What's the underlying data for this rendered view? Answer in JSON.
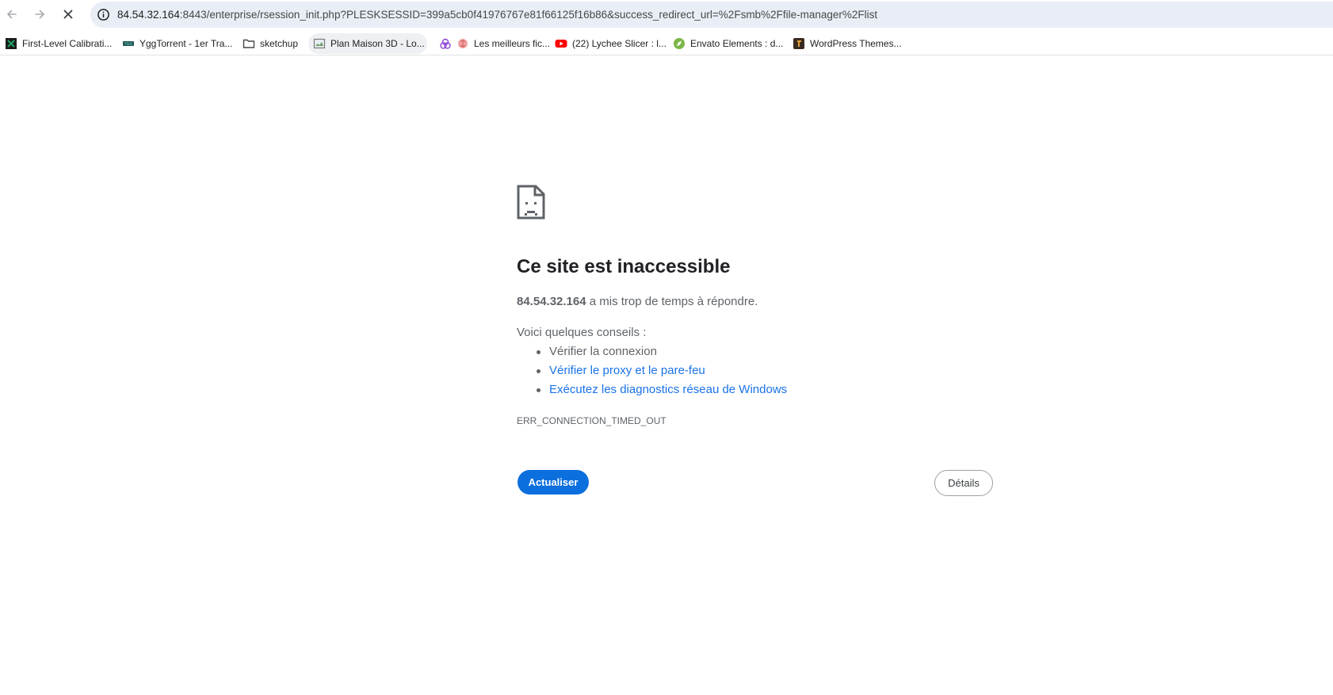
{
  "toolbar": {
    "url_host": "84.54.32.164",
    "url_rest": ":8443/enterprise/rsession_init.php?PLESKSESSID=399a5cb0f41976767e81f66125f16b86&success_redirect_url=%2Fsmb%2Ffile-manager%2Flist",
    "icons": {
      "back": "arrow-left-icon",
      "forward": "arrow-right-icon",
      "stop": "close-icon",
      "site_info": "info-icon"
    }
  },
  "bookmarks": [
    {
      "label": "First-Level Calibrati...",
      "icon": "excel-green-icon"
    },
    {
      "label": "YggTorrent - 1er Tra...",
      "icon": "ygg-icon"
    },
    {
      "label": "sketchup",
      "icon": "folder-icon"
    },
    {
      "label": "Plan Maison 3D - Lo...",
      "icon": "image-icon"
    },
    {
      "label": "Les meilleurs fic...",
      "icon": "brain-icon"
    },
    {
      "label": "(22) Lychee Slicer : l...",
      "icon": "youtube-icon"
    },
    {
      "label": "Envato Elements : d...",
      "icon": "leaf-icon"
    },
    {
      "label": "WordPress Themes...",
      "icon": "themeforest-icon"
    }
  ],
  "error": {
    "title": "Ce site est inaccessible",
    "host": "84.54.32.164",
    "summary_rest": " a mis trop de temps à répondre.",
    "tips_label": "Voici quelques conseils :",
    "tips": [
      "Vérifier la connexion",
      "Vérifier le proxy et le pare-feu",
      "Exécutez les diagnostics réseau de Windows"
    ],
    "code": "ERR_CONNECTION_TIMED_OUT",
    "reload_label": "Actualiser",
    "details_label": "Détails"
  },
  "colors": {
    "primary_button": "#0b6fde",
    "link": "#1a73e8",
    "omnibox_bg": "#e9eef6"
  }
}
